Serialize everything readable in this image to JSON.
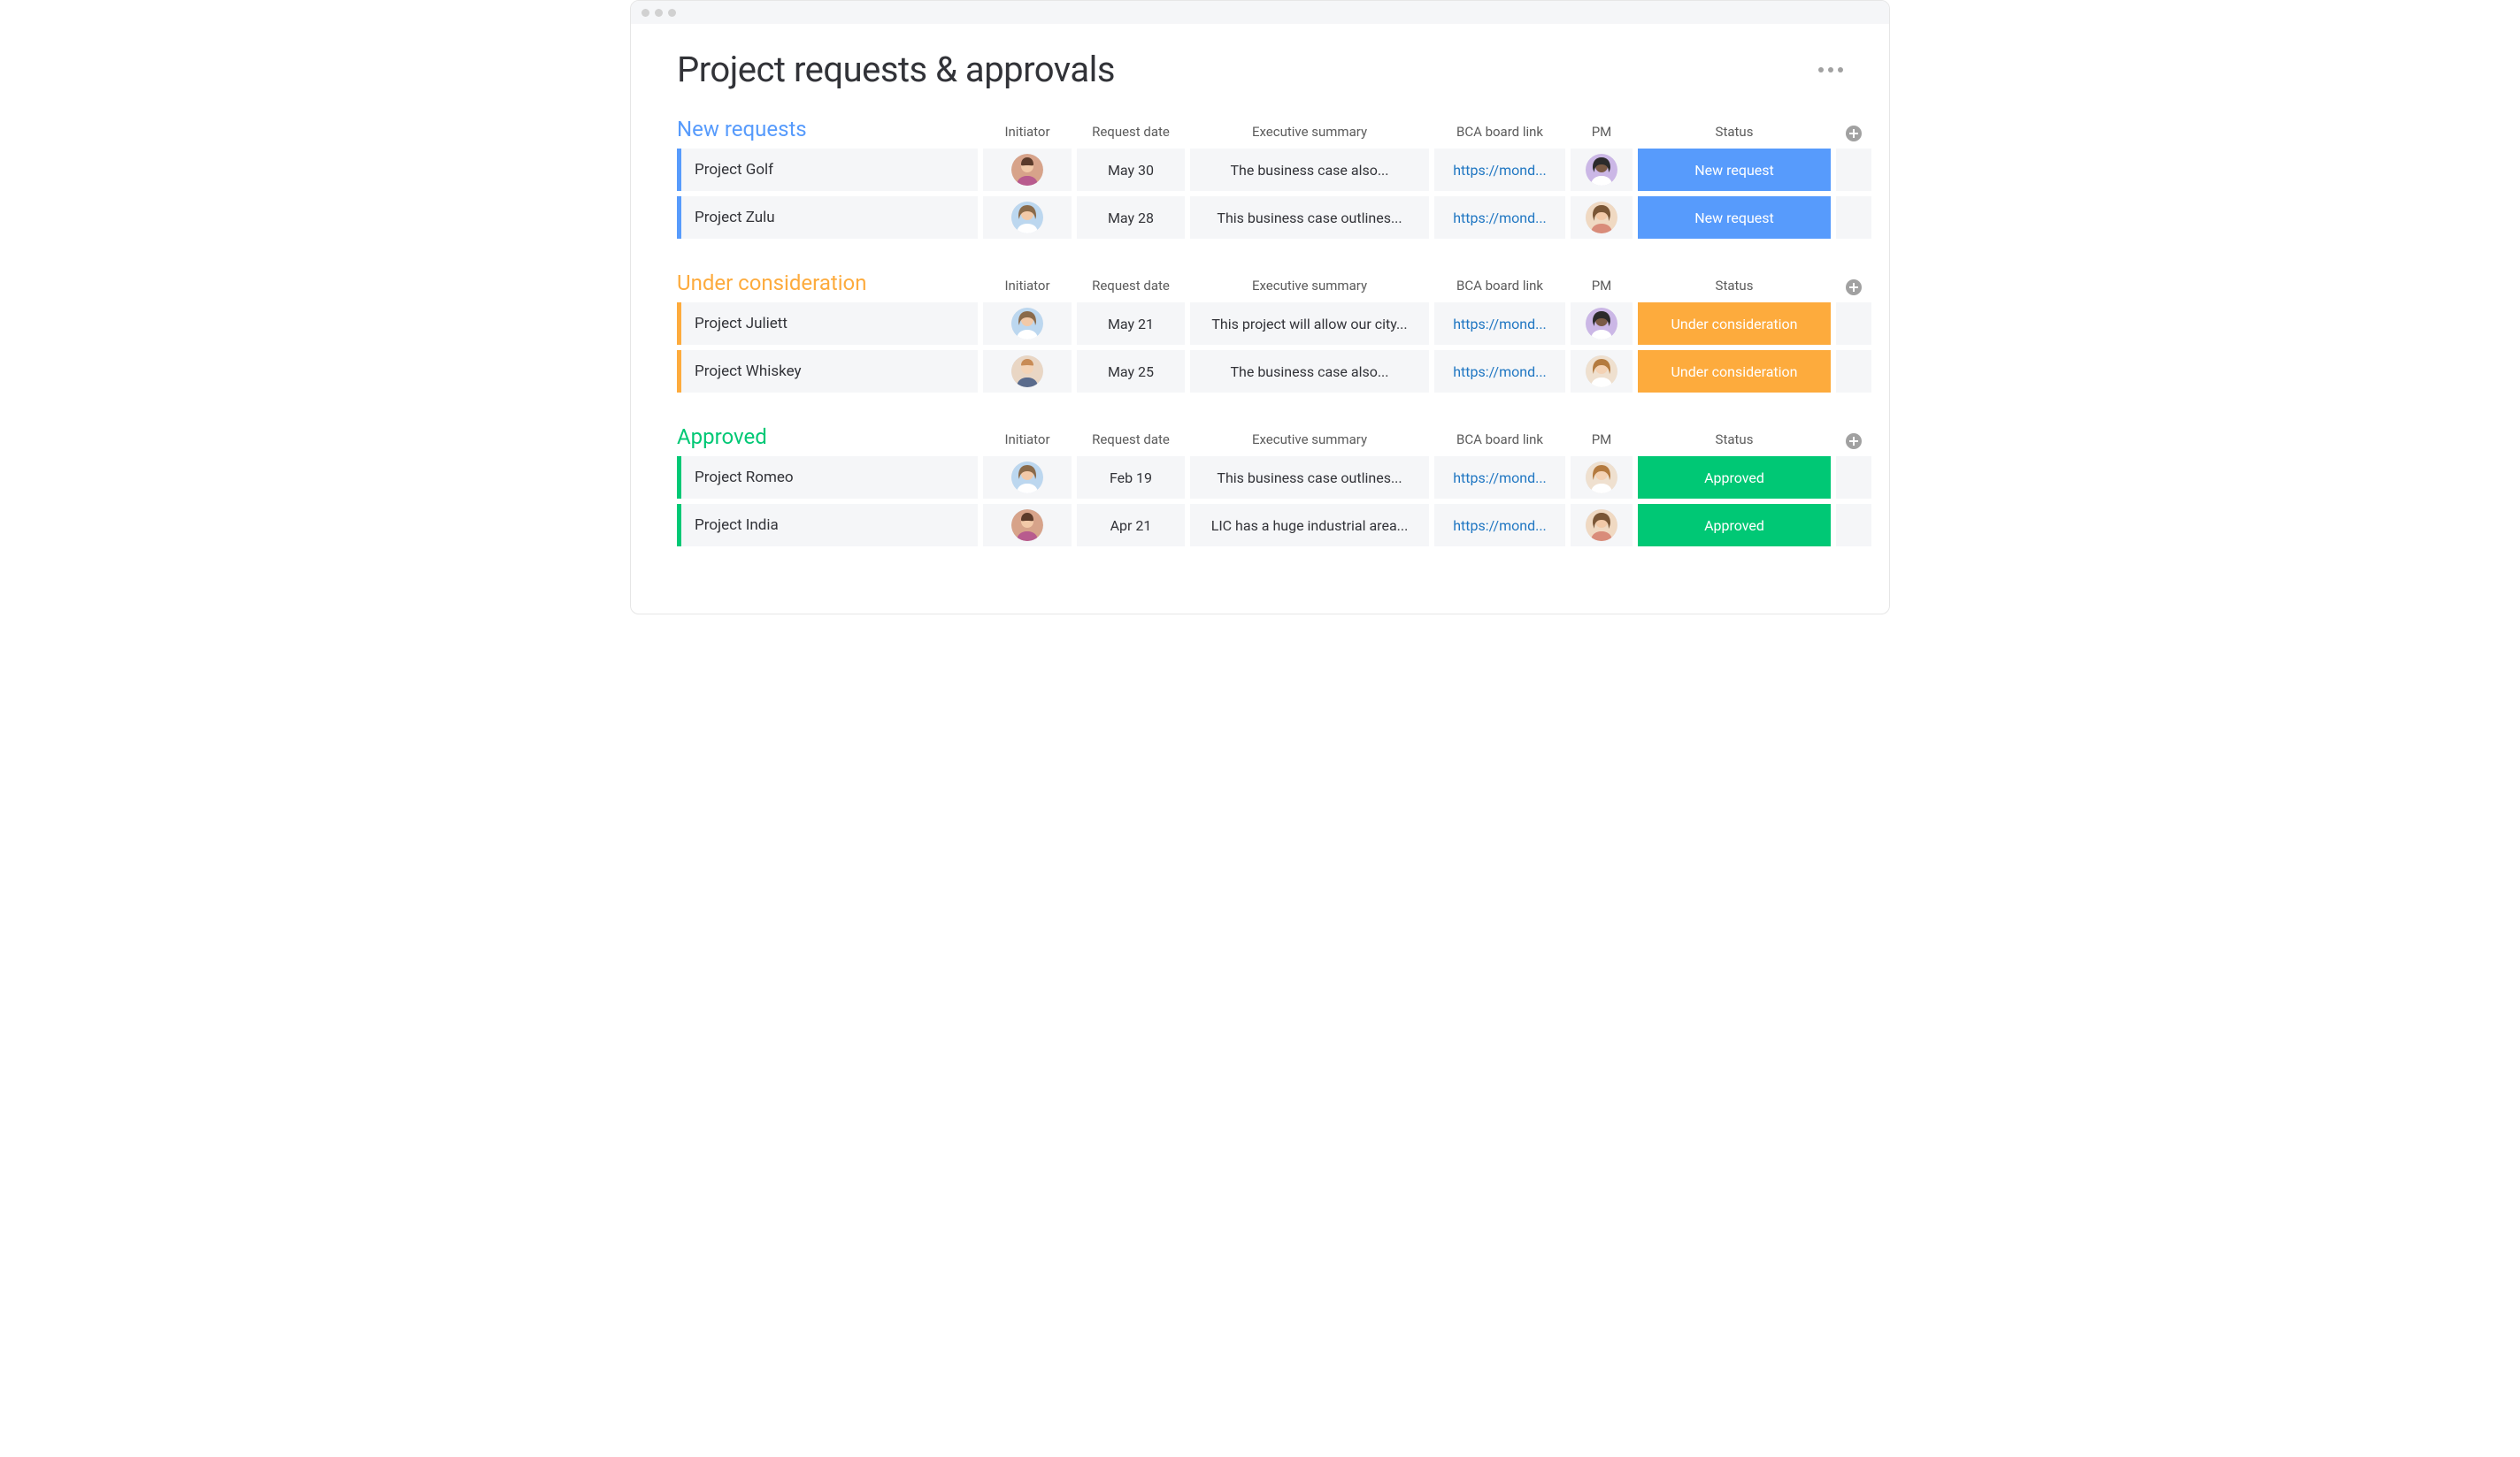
{
  "page": {
    "title": "Project requests & approvals"
  },
  "columns": {
    "initiator": "Initiator",
    "request_date": "Request date",
    "summary": "Executive summary",
    "bca": "BCA board link",
    "pm": "PM",
    "status": "Status"
  },
  "status_colors": {
    "new_request": "#579bfc",
    "under_consideration": "#fdab3d",
    "approved": "#00c875"
  },
  "groups": [
    {
      "id": "new",
      "title": "New requests",
      "class": "group-blue",
      "rows": [
        {
          "name": "Project Golf",
          "initiator_avatar": "m1",
          "date": "May 30",
          "summary": "The business case also...",
          "link": "https://mond...",
          "pm_avatar": "f1",
          "status_label": "New request",
          "status_color": "#579bfc"
        },
        {
          "name": "Project Zulu",
          "initiator_avatar": "f2",
          "date": "May 28",
          "summary": "This business case outlines...",
          "link": "https://mond...",
          "pm_avatar": "f3",
          "status_label": "New request",
          "status_color": "#579bfc"
        }
      ]
    },
    {
      "id": "under",
      "title": "Under consideration",
      "class": "group-orange",
      "rows": [
        {
          "name": "Project Juliett",
          "initiator_avatar": "f2",
          "date": "May 21",
          "summary": "This project will allow our city...",
          "link": "https://mond...",
          "pm_avatar": "f1",
          "status_label": "Under consideration",
          "status_color": "#fdab3d"
        },
        {
          "name": "Project Whiskey",
          "initiator_avatar": "m2",
          "date": "May 25",
          "summary": "The business case also...",
          "link": "https://mond...",
          "pm_avatar": "f4",
          "status_label": "Under consideration",
          "status_color": "#fdab3d"
        }
      ]
    },
    {
      "id": "approved",
      "title": "Approved",
      "class": "group-green",
      "rows": [
        {
          "name": "Project Romeo",
          "initiator_avatar": "f2",
          "date": "Feb 19",
          "summary": "This business case outlines...",
          "link": "https://mond...",
          "pm_avatar": "f4",
          "status_label": "Approved",
          "status_color": "#00c875"
        },
        {
          "name": "Project India",
          "initiator_avatar": "m1",
          "date": "Apr 21",
          "summary": "LIC has a huge industrial area...",
          "link": "https://mond...",
          "pm_avatar": "f3",
          "status_label": "Approved",
          "status_color": "#00c875"
        }
      ]
    }
  ]
}
